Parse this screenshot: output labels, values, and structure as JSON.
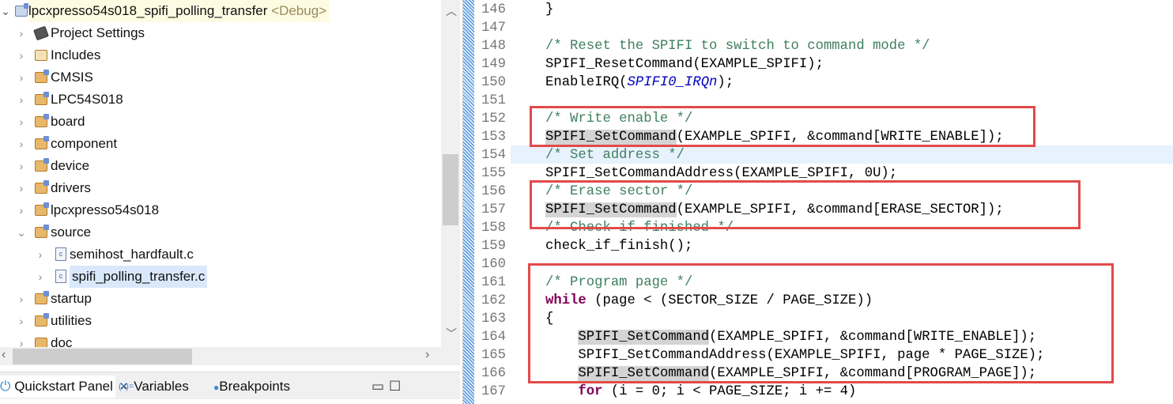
{
  "tree": {
    "project": {
      "name": "lpcxpresso54s018_spifi_polling_transfer",
      "config": "<Debug>"
    },
    "items": [
      {
        "label": "Project Settings",
        "icon": "settings-icon"
      },
      {
        "label": "Includes",
        "icon": "includes-icon"
      },
      {
        "label": "CMSIS",
        "icon": "source-folder-icon"
      },
      {
        "label": "LPC54S018",
        "icon": "source-folder-icon"
      },
      {
        "label": "board",
        "icon": "source-folder-icon"
      },
      {
        "label": "component",
        "icon": "source-folder-icon"
      },
      {
        "label": "device",
        "icon": "source-folder-icon"
      },
      {
        "label": "drivers",
        "icon": "source-folder-icon"
      },
      {
        "label": "lpcxpresso54s018",
        "icon": "source-folder-icon"
      },
      {
        "label": "source",
        "icon": "source-folder-icon"
      },
      {
        "label": "semihost_hardfault.c",
        "icon": "c-file-icon"
      },
      {
        "label": "spifi_polling_transfer.c",
        "icon": "c-file-icon"
      },
      {
        "label": "startup",
        "icon": "source-folder-icon"
      },
      {
        "label": "utilities",
        "icon": "source-folder-icon"
      },
      {
        "label": "doc",
        "icon": "folder-icon"
      }
    ]
  },
  "bottom_tabs": [
    {
      "label": "Quickstart Panel",
      "close": "×"
    },
    {
      "label": "Variables",
      "prefix": "(x)="
    },
    {
      "label": "Breakpoints"
    }
  ],
  "editor": {
    "line_numbers": [
      "146",
      "147",
      "148",
      "149",
      "150",
      "151",
      "152",
      "153",
      "154",
      "155",
      "156",
      "157",
      "158",
      "159",
      "160",
      "161",
      "162",
      "163",
      "164",
      "165",
      "166",
      "167"
    ],
    "lines": [
      [
        {
          "t": "}"
        }
      ],
      [],
      [
        {
          "t": "/* Reset the SPIFI to switch to command mode */",
          "c": "cm"
        }
      ],
      [
        {
          "t": "SPIFI_ResetCommand(EXAMPLE_SPIFI);"
        }
      ],
      [
        {
          "t": "EnableIRQ("
        },
        {
          "t": "SPIFI0_IRQn",
          "c": "it"
        },
        {
          "t": ");"
        }
      ],
      [],
      [
        {
          "t": "/* Write enable */",
          "c": "cm"
        }
      ],
      [
        {
          "t": "SPIFI_SetCommand",
          "c": "hl"
        },
        {
          "t": "(EXAMPLE_SPIFI, &command[WRITE_ENABLE]);"
        }
      ],
      [
        {
          "t": "/* Set address */",
          "c": "cm"
        }
      ],
      [
        {
          "t": "SPIFI_SetCommandAddress(EXAMPLE_SPIFI, 0U);"
        }
      ],
      [
        {
          "t": "/* Erase sector */",
          "c": "cm"
        }
      ],
      [
        {
          "t": "SPIFI_SetCommand",
          "c": "hl"
        },
        {
          "t": "(EXAMPLE_SPIFI, &command[ERASE_SECTOR]);"
        }
      ],
      [
        {
          "t": "/* Check if finished */",
          "c": "cm"
        }
      ],
      [
        {
          "t": "check_if_finish();"
        }
      ],
      [],
      [
        {
          "t": "/* Program page */",
          "c": "cm"
        }
      ],
      [
        {
          "t": "while",
          "c": "kw"
        },
        {
          "t": " (page < (SECTOR_SIZE / PAGE_SIZE))"
        }
      ],
      [
        {
          "t": "{"
        }
      ],
      [
        {
          "t": "    "
        },
        {
          "t": "SPIFI_SetCommand",
          "c": "hl"
        },
        {
          "t": "(EXAMPLE_SPIFI, &command[WRITE_ENABLE]);"
        }
      ],
      [
        {
          "t": "    SPIFI_SetCommandAddress(EXAMPLE_SPIFI, page * PAGE_SIZE);"
        }
      ],
      [
        {
          "t": "    "
        },
        {
          "t": "SPIFI_SetCommand",
          "c": "hl"
        },
        {
          "t": "(EXAMPLE_SPIFI, &command[PROGRAM_PAGE]);"
        }
      ],
      [
        {
          "t": "    "
        },
        {
          "t": "for",
          "c": "kw"
        },
        {
          "t": " (i = 0; i < PAGE_SIZE; i += 4)"
        }
      ]
    ]
  }
}
